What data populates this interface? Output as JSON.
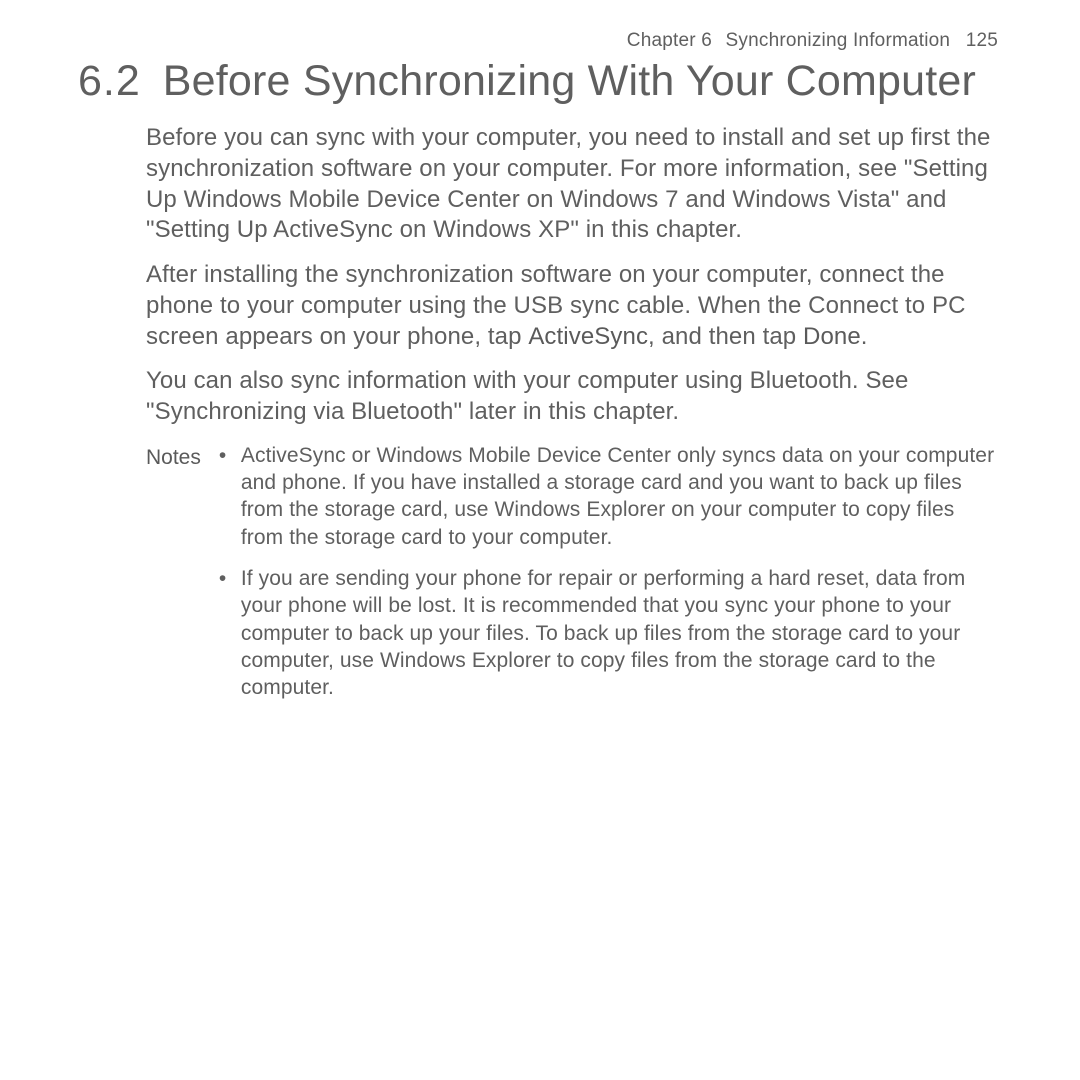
{
  "header": {
    "chapter_number": "Chapter 6",
    "chapter_title": "Synchronizing Information",
    "page_number": "125"
  },
  "section": {
    "number": "6.2",
    "title": "Before Synchronizing With Your Computer"
  },
  "paragraphs": {
    "p1": "Before you can sync with your computer, you need to install and set up first the synchronization software on your computer. For more information, see \"Setting Up Windows Mobile Device Center on Windows 7 and Windows Vista\" and \"Setting Up ActiveSync on Windows XP\" in this chapter.",
    "p2a": "After installing the synchronization software on your computer, connect the phone to your computer using the USB sync cable. When the Connect to PC screen appears on your phone, tap ",
    "p2b_bold": "ActiveSync",
    "p2c": ", and then tap ",
    "p2d_bold": "Done",
    "p2e": ".",
    "p3": "You can also sync information with your computer using Bluetooth. See \"Synchronizing via Bluetooth\" later in this chapter."
  },
  "notes": {
    "label": "Notes",
    "items": [
      "ActiveSync or Windows Mobile Device Center only syncs data on your computer and phone. If you have installed a storage card and you want to back up files from the storage card, use Windows Explorer on your computer to copy files from the storage card to your computer.",
      "If you are sending your phone for repair or performing a hard reset, data from your phone will be lost. It is recommended that you sync your phone to your computer to back up your files. To back up files from the storage card to your computer, use Windows Explorer to copy files from the storage card to the computer."
    ]
  }
}
